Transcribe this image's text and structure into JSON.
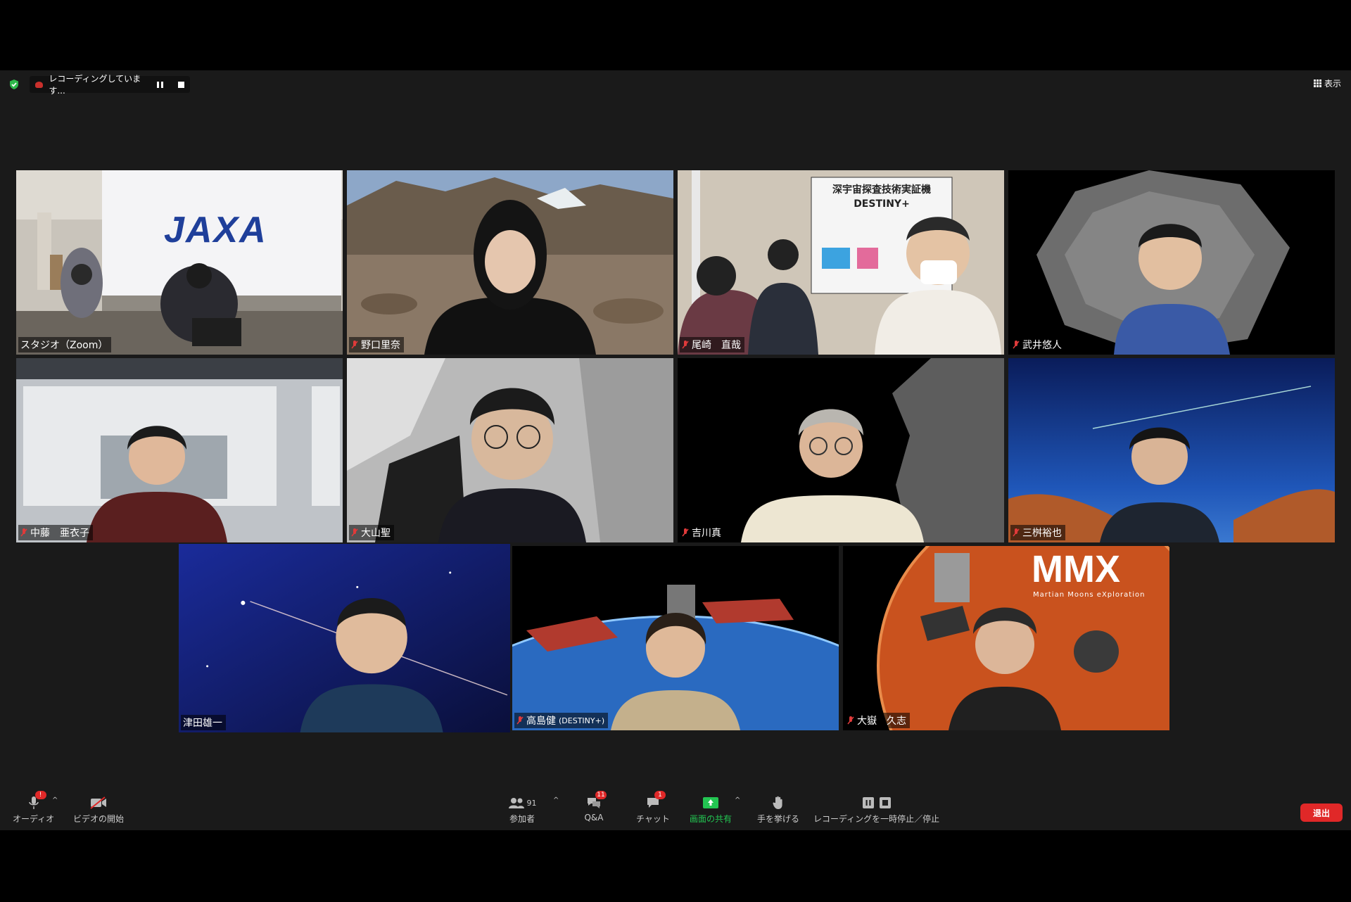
{
  "top_bar": {
    "recording_status": "レコーディングしています...",
    "view_label": "表示"
  },
  "participants": [
    {
      "name": "スタジオ（Zoom）",
      "muted": false,
      "background": "studio-with-jaxa-screen",
      "screen_text": "JAXA"
    },
    {
      "name": "野口里奈",
      "muted": true,
      "background": "rocky-mountain-landscape"
    },
    {
      "name": "尾崎　直哉",
      "muted": true,
      "background": "office-with-destiny-poster",
      "poster_text": "深宇宙探査技術実証機 DESTINY+"
    },
    {
      "name": "武井悠人",
      "muted": true,
      "background": "asteroid-ryugu"
    },
    {
      "name": "中藤　亜衣子",
      "muted": true,
      "background": "clean-room-lab"
    },
    {
      "name": "大山聖",
      "muted": true,
      "background": "lunar-cave-surface"
    },
    {
      "name": "吉川真",
      "muted": true,
      "background": "asteroid-close-up"
    },
    {
      "name": "三桝裕也",
      "muted": true,
      "background": "night-sky-milky-way"
    },
    {
      "name": "津田雄一",
      "muted": false,
      "active": true,
      "background": "starry-sky-meteor"
    },
    {
      "name": "高島健",
      "name_suffix": "(DESTINY+)",
      "muted": true,
      "background": "spacecraft-over-earth"
    },
    {
      "name": "大嶽　久志",
      "muted": true,
      "background": "mmx-mars-moons",
      "logo_text": "MMX",
      "logo_subtext": "Martian Moons eXploration"
    }
  ],
  "toolbar": {
    "audio_label": "オーディオ",
    "video_label": "ビデオの開始",
    "participants_label": "参加者",
    "participants_count": "91",
    "qa_label": "Q&A",
    "qa_badge": "11",
    "chat_label": "チャット",
    "chat_badge": "1",
    "share_label": "画面の共有",
    "raise_hand_label": "手を挙げる",
    "recording_label": "レコーディングを一時停止／停止",
    "leave_label": "退出"
  },
  "colors": {
    "active_speaker_border": "#d9e26a",
    "share_green": "#23c552",
    "leave_red": "#e02828",
    "muted_red": "#e03a3a"
  }
}
